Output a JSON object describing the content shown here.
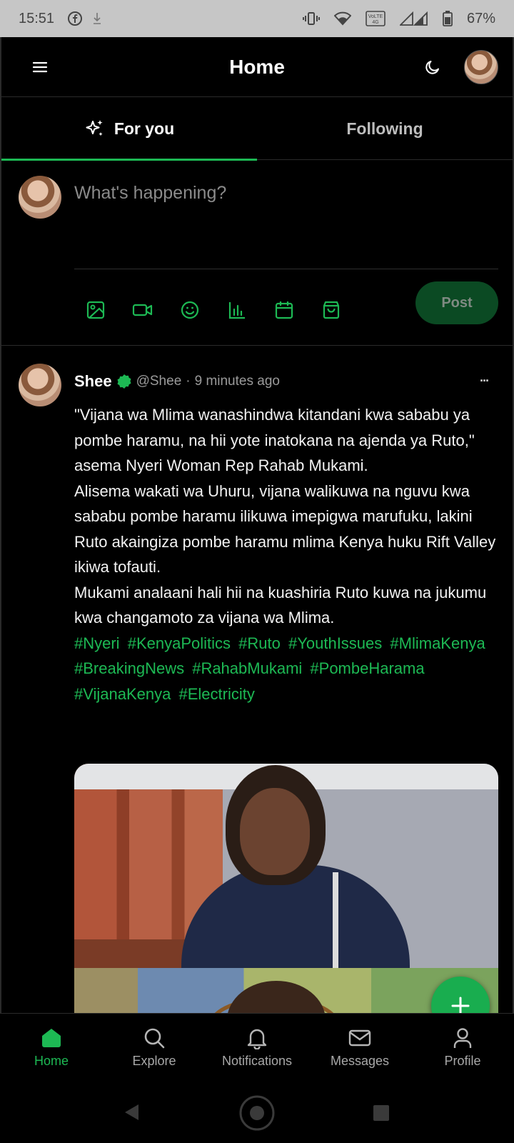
{
  "status_bar": {
    "time": "15:51",
    "battery": "67%",
    "icons": [
      "facebook-icon",
      "download-icon",
      "vibrate-icon",
      "wifi-icon",
      "volte-icon",
      "signal-icon",
      "battery-icon"
    ]
  },
  "header": {
    "title": "Home",
    "icons": [
      "menu-icon",
      "moon-icon"
    ]
  },
  "tabs": [
    {
      "label": "For you",
      "active": true,
      "icon": "sparkles-icon"
    },
    {
      "label": "Following",
      "active": false
    }
  ],
  "composer": {
    "placeholder": "What's happening?",
    "tools": [
      "image-icon",
      "video-icon",
      "emoji-icon",
      "poll-icon",
      "calendar-icon",
      "shopping-bag-icon"
    ],
    "post_label": "Post"
  },
  "post": {
    "author": "Shee",
    "handle": "@Shee",
    "separator": "·",
    "time": "9 minutes ago",
    "more": "···",
    "paragraphs": [
      "\"Vijana wa Mlima wanashindwa kitandani kwa sababu ya pombe haramu, na hii yote inatokana na ajenda ya Ruto,\" asema Nyeri Woman Rep Rahab Mukami.",
      "Alisema wakati wa Uhuru, vijana walikuwa na nguvu kwa sababu pombe haramu ilikuwa imepigwa marufuku, lakini Ruto akaingiza pombe haramu mlima Kenya huku Rift Valley ikiwa tofauti.",
      "Mukami analaani hali hii na kuashiria Ruto kuwa na jukumu kwa changamoto za vijana wa Mlima."
    ],
    "hashtags": [
      "#Nyeri",
      "#KenyaPolitics",
      "#Ruto",
      "#YouthIssues",
      "#MlimaKenya",
      "#BreakingNews",
      "#RahabMukami",
      "#PombeHarama",
      "#VijanaKenya",
      "#Electricity"
    ]
  },
  "bottom_nav": [
    {
      "label": "Home",
      "icon": "home-icon",
      "active": true
    },
    {
      "label": "Explore",
      "icon": "search-icon",
      "active": false
    },
    {
      "label": "Notifications",
      "icon": "bell-icon",
      "active": false
    },
    {
      "label": "Messages",
      "icon": "mail-icon",
      "active": false
    },
    {
      "label": "Profile",
      "icon": "user-icon",
      "active": false
    }
  ],
  "colors": {
    "accent": "#1db954",
    "background": "#000000",
    "post_button_bg": "#0b4a23",
    "fab": "#19ad4f",
    "muted_text": "#9a9a9a"
  }
}
